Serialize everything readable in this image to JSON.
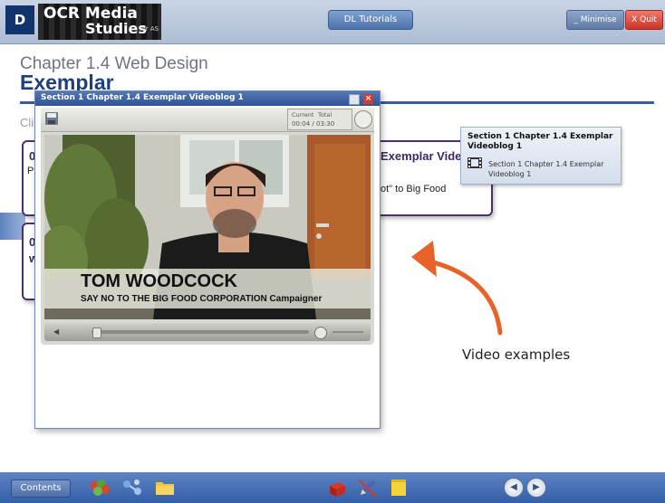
{
  "app": {
    "logo_letter": "D",
    "logo_line1": "OCR Media",
    "logo_line2": "Studies",
    "logo_line3": "for AS"
  },
  "toolbar": {
    "dl_tutorials_label": "DL Tutorials",
    "minimise_label": "_ Minimise",
    "quit_label": "X Quit"
  },
  "page": {
    "chapter_title": "Chapter 1.4 Web Design",
    "heading": "Exemplar",
    "partial_letter": "Cli"
  },
  "cards": [
    {
      "number": "0",
      "title_partial": "Exemplar Vide",
      "text_left": "Pr",
      "text_right": "ot\" to Big Food"
    },
    {
      "number": "0",
      "text_left": "w"
    }
  ],
  "tooltip": {
    "title": "Section 1 Chapter 1.4 Exemplar Videoblog 1",
    "item_label": "Section 1 Chapter 1.4 Exemplar Videoblog 1",
    "item_icon": "film-icon"
  },
  "video_window": {
    "title": "Section 1 Chapter 1.4 Exemplar Videoblog 1",
    "current_label": "Current",
    "total_label": "Total",
    "current_time": "00:04",
    "separator": "/",
    "total_time": "03:30",
    "caption_name": "TOM WOODCOCK",
    "caption_subtitle": "SAY NO TO THE BIG FOOD CORPORATION Campaigner",
    "progress": 0.02
  },
  "annotation": {
    "label": "Video examples",
    "color": "#e8622a"
  },
  "taskbar": {
    "contents_label": "Contents",
    "icons": [
      "grapes-icon",
      "molecule-icon",
      "folder-icon",
      "gift-icon",
      "pencil-icon",
      "note-icon"
    ],
    "prev_label": "◀",
    "next_label": "▶"
  }
}
